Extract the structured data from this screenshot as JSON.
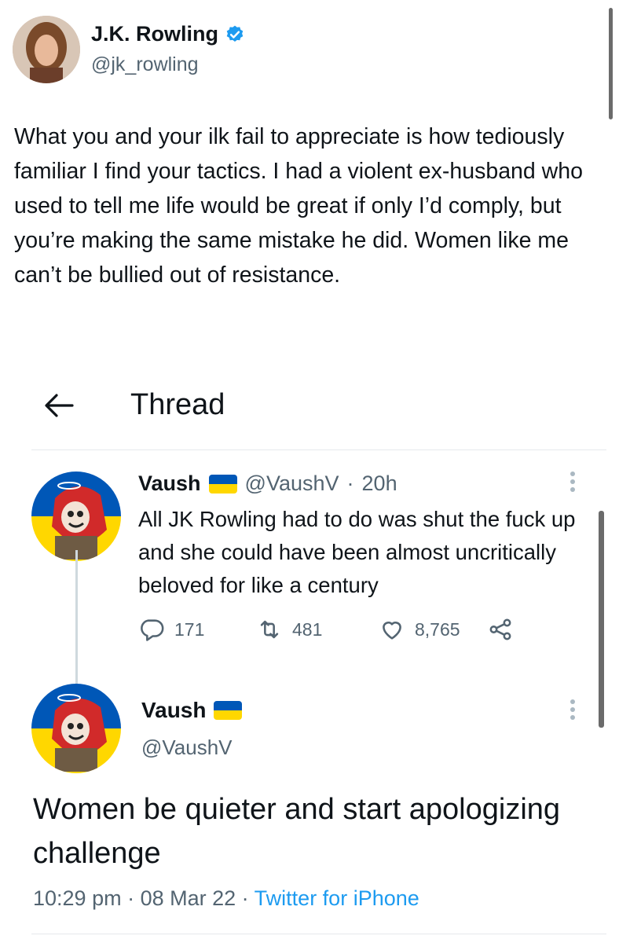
{
  "outer_tweet": {
    "author_name": "J.K. Rowling",
    "author_handle": "@jk_rowling",
    "verified_icon": "verified-badge-icon",
    "text": "What you and your ilk fail to appreciate is how tediously familiar I find your tactics. I had a violent ex-husband who used to tell me life would be great if only I’d comply, but you’re making the same mistake he did. Women like me can’t be bullied out of resistance."
  },
  "thread_header": {
    "title": "Thread",
    "back_icon": "back-arrow-icon"
  },
  "reply_tweet": {
    "author_name": "Vaush",
    "author_handle": "@VaushV",
    "separator": "·",
    "time": "20h",
    "text": "All JK Rowling had to do was shut the fuck up and she could have been almost uncritically beloved for like a century",
    "stats": {
      "replies": "171",
      "retweets": "481",
      "likes": "8,765"
    }
  },
  "main_tweet": {
    "author_name": "Vaush",
    "author_handle": "@VaushV",
    "text": "Women be quieter and start apologizing challenge",
    "time": "10:29 pm",
    "sep1": " · ",
    "date": "08 Mar 22",
    "sep2": " · ",
    "source": "Twitter for iPhone"
  },
  "colors": {
    "text": "#0f1419",
    "muted": "#536471",
    "link": "#1d9bf0",
    "verified": "#1d9bf0",
    "flag_blue": "#0057b7",
    "flag_yellow": "#ffd700"
  }
}
